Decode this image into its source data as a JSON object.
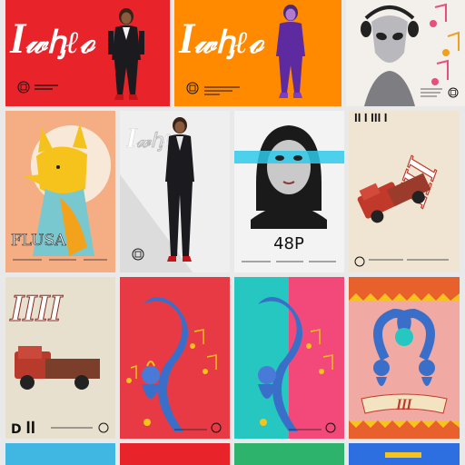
{
  "colors": {
    "red": "#e8232a",
    "orange": "#ff8a00",
    "teal": "#25c7c0",
    "cream": "#efe5d2",
    "grey": "#d9d9d9",
    "blue_snake": "#3a6fc9",
    "yellow": "#f6c21c"
  },
  "tiles": [
    {
      "id": "t1",
      "heading": "ꟾ𝓌ꞕℓℴ",
      "subtitle": "ꟾ ꟾꟾꟾ ꟾꟾ ꟾꟾꟾ",
      "icon": "seal-icon"
    },
    {
      "id": "t2",
      "heading": "ꟾ𝓌ꞕℓℴ",
      "subtitle": "ꟾꟾ ꟾꟾꟾ ꟾꟾꟾ",
      "icon": "seal-icon"
    },
    {
      "id": "t3",
      "heading": "",
      "subtitle": "ꟾꟾ ꟾꟾ ꟾꟾꟾ",
      "icon": "seal-icon"
    },
    {
      "id": "t4",
      "heading": "FLUSA",
      "subtitle": "",
      "icon": "seal-icon"
    },
    {
      "id": "t5",
      "heading": "ꟾ𝓌ꞕℓℴ",
      "subtitle": "",
      "icon": "seal-icon"
    },
    {
      "id": "t6",
      "heading": "48P",
      "subtitle": "",
      "icon": "seal-icon"
    },
    {
      "id": "t7",
      "heading": "ꟾꟾ ꟾ ꟾꟾꟾ ꟾ",
      "subtitle": "",
      "icon": "seal-icon"
    },
    {
      "id": "t8",
      "heading": "ꟾꟾꟾꟾ",
      "subtitle": "",
      "icon": "seal-icon"
    },
    {
      "id": "t9",
      "heading": "",
      "subtitle": "",
      "icon": "seal-icon"
    },
    {
      "id": "t10",
      "heading": "",
      "subtitle": "",
      "icon": "seal-icon"
    },
    {
      "id": "t11",
      "heading": "",
      "subtitle": "",
      "icon": "seal-icon"
    },
    {
      "id": "t12",
      "heading": "ꟾꟾꟾ",
      "subtitle": "",
      "icon": "seal-icon"
    }
  ]
}
